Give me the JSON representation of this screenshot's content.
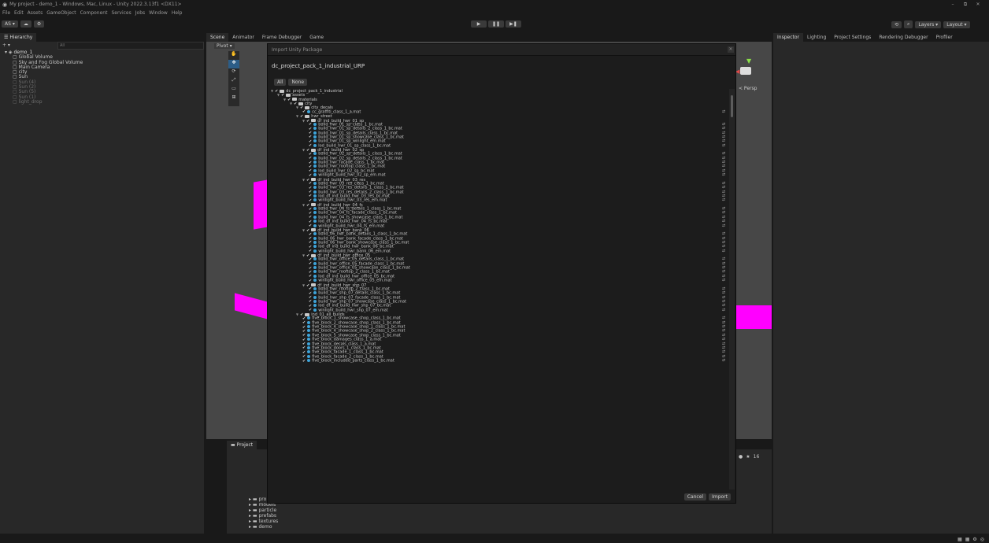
{
  "window": {
    "title": "My project - demo_1 - Windows, Mac, Linux - Unity 2022.3.13f1 <DX11>",
    "controls": [
      "–",
      "⧉",
      "✕"
    ]
  },
  "menu": [
    "File",
    "Edit",
    "Assets",
    "GameObject",
    "Component",
    "Services",
    "Jobs",
    "Window",
    "Help"
  ],
  "toolbar": {
    "account": "AS ▾",
    "layers": "Layers",
    "layout": "Layout"
  },
  "hierarchy": {
    "tab": "Hierarchy",
    "search_placeholder": "All",
    "scene": "demo_1",
    "items": [
      {
        "label": "Global Volume",
        "dim": false
      },
      {
        "label": "Sky and Fog Global Volume",
        "dim": false
      },
      {
        "label": "Main Camera",
        "dim": false
      },
      {
        "label": "city",
        "dim": false
      },
      {
        "label": "Sun",
        "dim": false
      },
      {
        "label": "Sun (4)",
        "dim": true
      },
      {
        "label": "Sun (2)",
        "dim": true
      },
      {
        "label": "Sun (5)",
        "dim": true
      },
      {
        "label": "Sun (1)",
        "dim": true
      },
      {
        "label": "light_drop",
        "dim": true
      }
    ]
  },
  "center_tabs": [
    "Scene",
    "Animator",
    "Frame Debugger",
    "Game"
  ],
  "scene_view": {
    "pivot": "Pivot",
    "persp": "< Persp"
  },
  "right_tabs": [
    "Inspector",
    "Lighting",
    "Project Settings",
    "Rendering Debugger",
    "Profiler"
  ],
  "project": {
    "tab": "Project",
    "folders": [
      "pro",
      "models",
      "particle",
      "prefabs",
      "textures",
      "demo"
    ],
    "count": "16"
  },
  "dialog": {
    "title": "Import Unity Package",
    "package": "dc_project_pack_1_industrial_URP",
    "all_button": "All",
    "none_button": "None",
    "cancel_button": "Cancel",
    "import_button": "Import",
    "tree": [
      {
        "d": 0,
        "t": "f",
        "n": "dc_project_pack_1_industrial"
      },
      {
        "d": 1,
        "t": "f",
        "n": "assets"
      },
      {
        "d": 2,
        "t": "f",
        "n": "materials"
      },
      {
        "d": 3,
        "t": "f",
        "n": "city"
      },
      {
        "d": 4,
        "t": "f",
        "n": "city_decals"
      },
      {
        "d": 5,
        "t": "m",
        "n": "cc_graffiti_class_1_a.mat",
        "r": true
      },
      {
        "d": 4,
        "t": "f",
        "n": "hwr_street"
      },
      {
        "d": 5,
        "t": "f",
        "n": "df_ind_build_hwr_01_sp"
      },
      {
        "d": 6,
        "t": "m",
        "n": "build_hwr_01_sp_class_1_bc.mat",
        "r": true
      },
      {
        "d": 6,
        "t": "m",
        "n": "build_hwr_01_sp_details_2_class_1_bc.mat",
        "r": true
      },
      {
        "d": 6,
        "t": "m",
        "n": "build_hwr_01_sp_details_class_1_bc.mat",
        "r": true
      },
      {
        "d": 6,
        "t": "m",
        "n": "build_hwr_01_sp_showcase_class_1_bc.mat",
        "r": true
      },
      {
        "d": 6,
        "t": "m",
        "n": "build_hwr_01_sp_winlight_em.mat",
        "r": true
      },
      {
        "d": 6,
        "t": "m",
        "n": "lod_build_hwr_01_sp_class_1_bc.mat",
        "r": true
      },
      {
        "d": 5,
        "t": "f",
        "n": "df_ind_build_hwr_02_sp"
      },
      {
        "d": 6,
        "t": "m",
        "n": "build_hwr_02_sp_details_1_class_1_bc.mat",
        "r": true
      },
      {
        "d": 6,
        "t": "m",
        "n": "build_hwr_02_sp_details_2_class_1_bc.mat",
        "r": true
      },
      {
        "d": 6,
        "t": "m",
        "n": "build_hwr_facade_class_1_bc.mat",
        "r": true
      },
      {
        "d": 6,
        "t": "m",
        "n": "build_hwr_rooftop_class_1_bc.mat",
        "r": true
      },
      {
        "d": 6,
        "t": "m",
        "n": "lod_build_hwr_02_sp_bc.mat",
        "r": true
      },
      {
        "d": 6,
        "t": "m",
        "n": "winlight_build_hwr_02_sp_em.mat",
        "r": true
      },
      {
        "d": 5,
        "t": "f",
        "n": "df_ind_build_hwr_03_res"
      },
      {
        "d": 6,
        "t": "m",
        "n": "build_hwr_03_res_class_1_bc.mat",
        "r": true
      },
      {
        "d": 6,
        "t": "m",
        "n": "build_hwr_03_res_details_1_class_1_bc.mat",
        "r": true
      },
      {
        "d": 6,
        "t": "m",
        "n": "build_hwr_03_res_details_2_class_1_bc.mat",
        "r": true
      },
      {
        "d": 6,
        "t": "m",
        "n": "lod_df_ind_build_hwr_03_res_bc.mat",
        "r": true
      },
      {
        "d": 6,
        "t": "m",
        "n": "winlight_build_hwr_03_res_em.mat",
        "r": true
      },
      {
        "d": 5,
        "t": "f",
        "n": "df_ind_build_hwr_04_fs"
      },
      {
        "d": 6,
        "t": "m",
        "n": "build_hwr_04_fs_details_1_class_1_bc.mat",
        "r": true
      },
      {
        "d": 6,
        "t": "m",
        "n": "build_hwr_04_fs_facade_class_1_bc.mat",
        "r": true
      },
      {
        "d": 6,
        "t": "m",
        "n": "build_hwr_04_fs_showcase_class_1_bc.mat",
        "r": true
      },
      {
        "d": 6,
        "t": "m",
        "n": "lod_df_ind_build_hwr_04_fs_bc.mat",
        "r": true
      },
      {
        "d": 6,
        "t": "m",
        "n": "winlight_build_hwr_04_fs_em.mat",
        "r": true
      },
      {
        "d": 5,
        "t": "f",
        "n": "df_ind_build_hwr_bank_06"
      },
      {
        "d": 6,
        "t": "m",
        "n": "build_06_hwr_bank_details_1_class_1_bc.mat",
        "r": true
      },
      {
        "d": 6,
        "t": "m",
        "n": "build_06_hwr_bank_facade_class_1_bc.mat",
        "r": true
      },
      {
        "d": 6,
        "t": "m",
        "n": "build_06_hwr_bank_showcase_class_1_bc.mat",
        "r": true
      },
      {
        "d": 6,
        "t": "m",
        "n": "lod_df_ind_build_hwr_bank_06_bc.mat",
        "r": true
      },
      {
        "d": 6,
        "t": "m",
        "n": "winlight_build_hwr_bank_06_em.mat",
        "r": true
      },
      {
        "d": 5,
        "t": "f",
        "n": "df_ind_build_hwr_office_05"
      },
      {
        "d": 6,
        "t": "m",
        "n": "build_hwr_office_05_details_class_1_bc.mat",
        "r": true
      },
      {
        "d": 6,
        "t": "m",
        "n": "build_hwr_office_05_facade_class_1_bc.mat",
        "r": true
      },
      {
        "d": 6,
        "t": "m",
        "n": "build_hwr_office_05_showcase_class_1_bc.mat",
        "r": true
      },
      {
        "d": 6,
        "t": "m",
        "n": "build_hwr_rooftop_2_class_1_bc.mat",
        "r": true
      },
      {
        "d": 6,
        "t": "m",
        "n": "lod_df_ind_build_hwr_office_05_bc.mat",
        "r": true
      },
      {
        "d": 6,
        "t": "m",
        "n": "winlight_build_hwr_office_05_em.mat",
        "r": true
      },
      {
        "d": 5,
        "t": "f",
        "n": "df_ind_build_hwr_shp_07"
      },
      {
        "d": 6,
        "t": "m",
        "n": "build_hwr_rooftop_2_class_1_bc.mat",
        "r": true
      },
      {
        "d": 6,
        "t": "m",
        "n": "build_hwr_shp_07_details_class_1_bc.mat",
        "r": true
      },
      {
        "d": 6,
        "t": "m",
        "n": "build_hwr_shp_07_facade_class_1_bc.mat",
        "r": true
      },
      {
        "d": 6,
        "t": "m",
        "n": "build_hwr_shp_07_showcase_class_1_bc.mat",
        "r": true
      },
      {
        "d": 6,
        "t": "m",
        "n": "lod_df_ind_build_hwr_shp_07_bc.mat",
        "r": true
      },
      {
        "d": 6,
        "t": "m",
        "n": "winlight_build_hwr_shp_07_em.mat",
        "r": true
      },
      {
        "d": 4,
        "t": "f",
        "n": "ind_01_all_builds"
      },
      {
        "d": 5,
        "t": "m",
        "n": "five_block_1_showcase_shop_class_1_bc.mat",
        "r": true
      },
      {
        "d": 5,
        "t": "m",
        "n": "five_block_2_showcase_shop_class_1_bc.mat",
        "r": true
      },
      {
        "d": 5,
        "t": "m",
        "n": "five_block_4_showcase_shop_1_class_1_bc.mat",
        "r": true
      },
      {
        "d": 5,
        "t": "m",
        "n": "five_block_4_showcase_shop_2_class_1_bc.mat",
        "r": true
      },
      {
        "d": 5,
        "t": "m",
        "n": "five_block_5_showcase_shop_class_1_bc.mat",
        "r": true
      },
      {
        "d": 5,
        "t": "m",
        "n": "five_block_damages_class_1_a.mat",
        "r": true
      },
      {
        "d": 5,
        "t": "m",
        "n": "five_block_decals_class_1_a.mat",
        "r": true
      },
      {
        "d": 5,
        "t": "m",
        "n": "five_block_doors_1_class_1_bc.mat",
        "r": true
      },
      {
        "d": 5,
        "t": "m",
        "n": "five_block_facade_1_class_1_bc.mat",
        "r": true
      },
      {
        "d": 5,
        "t": "m",
        "n": "five_block_facade_2_class_1_bc.mat",
        "r": true
      },
      {
        "d": 5,
        "t": "m",
        "n": "five_block_included_parts_class_1_bc.mat",
        "r": true
      }
    ]
  }
}
